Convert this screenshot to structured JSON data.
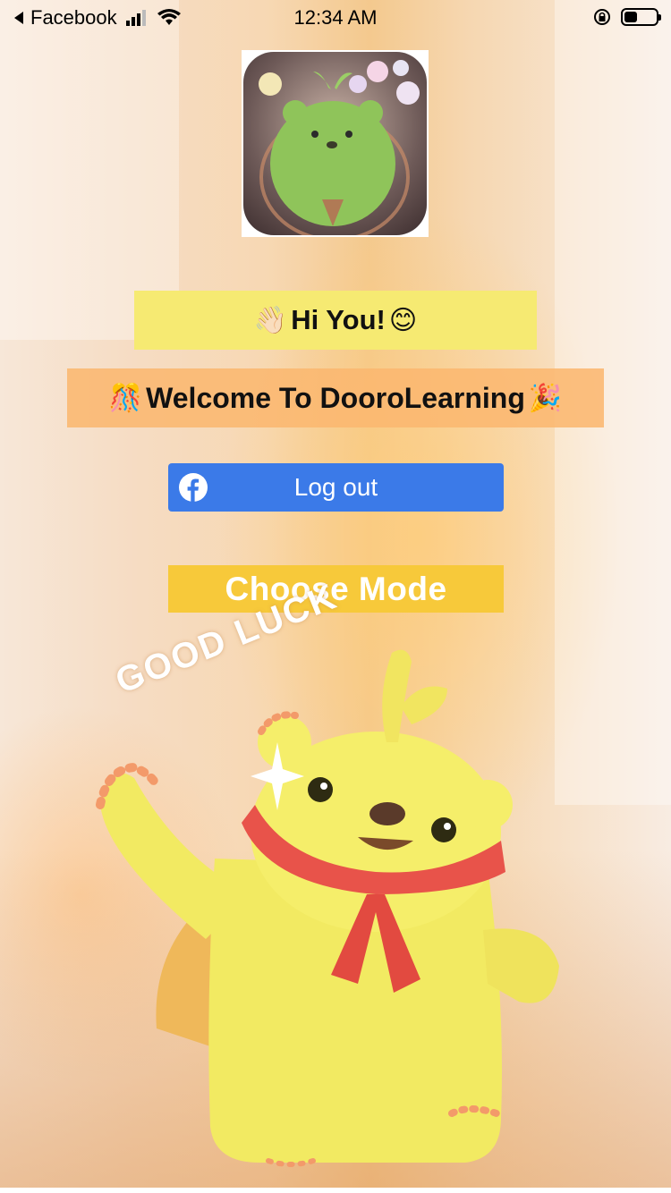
{
  "status_bar": {
    "back_app": "Facebook",
    "time": "12:34 AM",
    "battery_level": 0.4
  },
  "avatar": {
    "icon": "bear-avatar-icon"
  },
  "greeting": {
    "text": "Hi You!",
    "emoji_left": "👋🏻",
    "emoji_right": "😊"
  },
  "welcome": {
    "text": "Welcome To DooroLearning",
    "emoji_left": "🎊",
    "emoji_right": "🎉"
  },
  "logout_button": {
    "label": "Log out",
    "icon": "facebook-icon",
    "color": "#3b7ae8"
  },
  "choose_mode_button": {
    "label": "Choose Mode",
    "color": "#f7c93a"
  },
  "illustration": {
    "caption": "GOOD LUCK",
    "icon": "yellow-bear-mascot"
  }
}
